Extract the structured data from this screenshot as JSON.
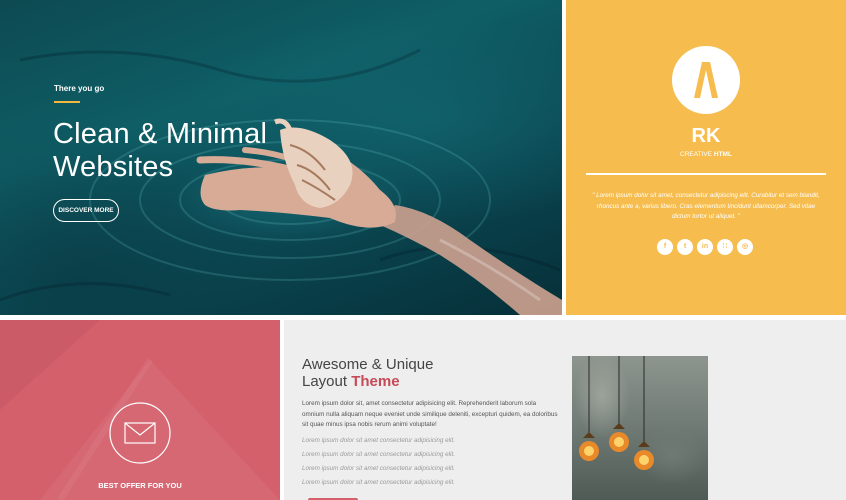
{
  "hero": {
    "eyebrow": "There you go",
    "title_line1": "Clean & Minimal",
    "title_line2": "Websites",
    "button_label": "DISCOVER MORE"
  },
  "profile_card": {
    "name": "RK",
    "subtitle_prefix": "CREATIVE",
    "subtitle_bold": "HTML",
    "quote": "\" Lorem ipsum dolor sit amet, consectetur adipiscing elit. Curabitur et sem blandit, rhoncus ante a, varius libero. Cras elementum tincidunt ullamcorper. Sed vitae dictum tortor ut aliquet. \"",
    "socials": [
      {
        "icon": "facebook-icon",
        "glyph": "f"
      },
      {
        "icon": "twitter-icon",
        "glyph": "t"
      },
      {
        "icon": "linkedin-icon",
        "glyph": "in"
      },
      {
        "icon": "rss-icon",
        "glyph": "∷"
      },
      {
        "icon": "dribbble-icon",
        "glyph": "◎"
      }
    ],
    "accent_color": "#f6bd4e"
  },
  "offer_card": {
    "label": "BEST OFFER FOR YOU",
    "icon": "envelope-icon",
    "color": "#d4606c"
  },
  "feature": {
    "heading_line1": "Awesome & Unique",
    "heading_line2_prefix": "Layout",
    "heading_line2_accent": "Theme",
    "paragraph": "Lorem ipsum dolor sit, amet consectetur adipisicing elit. Reprehenderit laborum sola omnium nulla aliquam neque eveniet unde similique deleniti, excepturi quidem, ea doloribus sit quae minus ipsa nobis rerum animi voluptate!",
    "italic_lines": [
      "Lorem ipsum dolor sit amet consectetur adipisicing elit.",
      "Lorem ipsum dolor sit amet consectetur adipisicing elit.",
      "Lorem ipsum dolor sit amet consectetur adipisicing elit.",
      "Lorem ipsum dolor sit amet consectetur adipisicing elit."
    ],
    "accent_color": "#c74a57"
  }
}
